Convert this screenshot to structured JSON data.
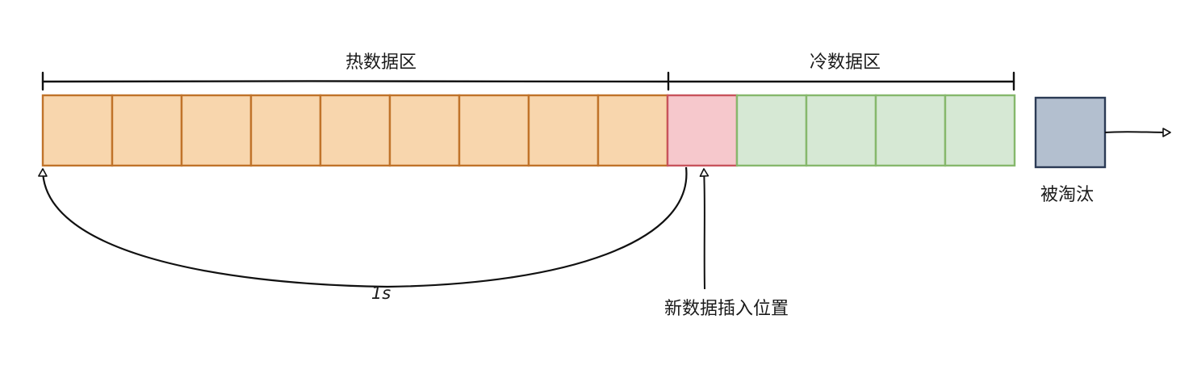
{
  "hot_zone": {
    "label": "热数据区",
    "cell_count": 9,
    "fill": "#f8d6ad",
    "stroke": "#c0732a"
  },
  "insert_cell": {
    "fill": "#f6c8cc",
    "stroke": "#c8545c"
  },
  "cold_zone": {
    "label": "冷数据区",
    "cell_count": 4,
    "fill": "#d6e8d4",
    "stroke": "#86b86c"
  },
  "evicted": {
    "label": "被淘汰",
    "fill": "#b3bfcf",
    "stroke": "#2b3a55"
  },
  "insert_position": {
    "label": "新数据插入位置"
  },
  "interval": {
    "label": "1s"
  }
}
